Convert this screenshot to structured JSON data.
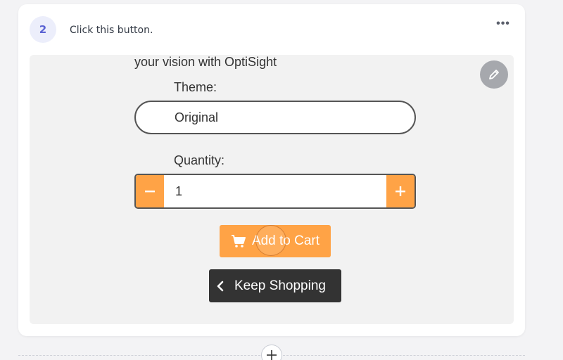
{
  "step": {
    "number": "2",
    "instruction": "Click this button."
  },
  "screenshot": {
    "heading_fragment": "your vision with OptiSight",
    "theme_label": "Theme:",
    "theme_value": "Original",
    "quantity_label": "Quantity:",
    "quantity_value": "1",
    "add_to_cart_label": "Add to Cart",
    "keep_shopping_label": "Keep Shopping"
  },
  "icons": {
    "more": "more-horizontal-icon",
    "edit": "pencil-icon",
    "minus": "minus-icon",
    "plus": "plus-icon",
    "cart": "cart-icon",
    "back": "chevron-left-icon",
    "add_step": "plus-icon"
  },
  "colors": {
    "accent_orange": "#ffa346",
    "dark_button": "#333333",
    "badge_text": "#5b63d3"
  }
}
